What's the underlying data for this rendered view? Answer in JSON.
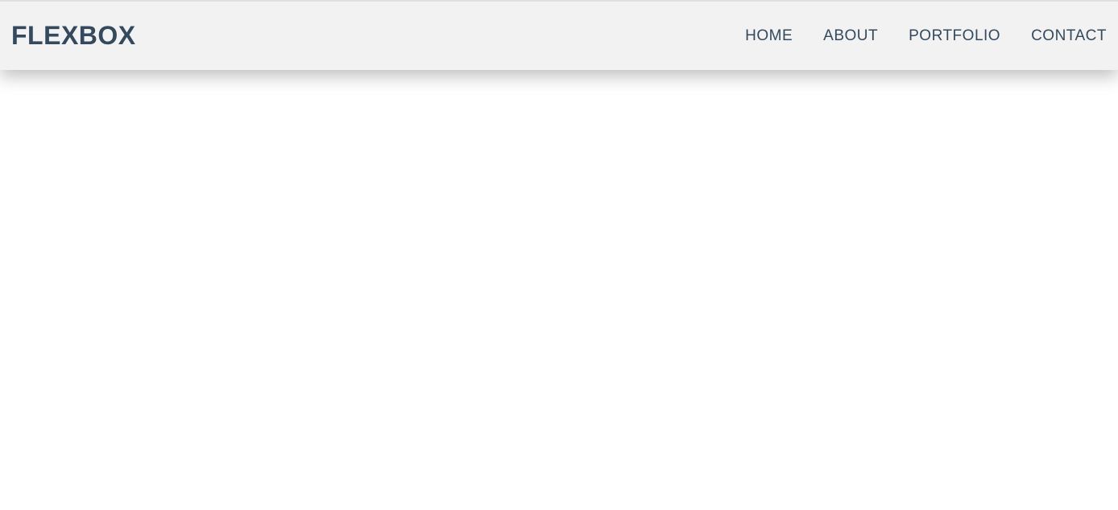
{
  "header": {
    "logo": "FLEXBOX",
    "nav": {
      "items": [
        {
          "label": "HOME"
        },
        {
          "label": "ABOUT"
        },
        {
          "label": "PORTFOLIO"
        },
        {
          "label": "CONTACT"
        }
      ]
    }
  }
}
